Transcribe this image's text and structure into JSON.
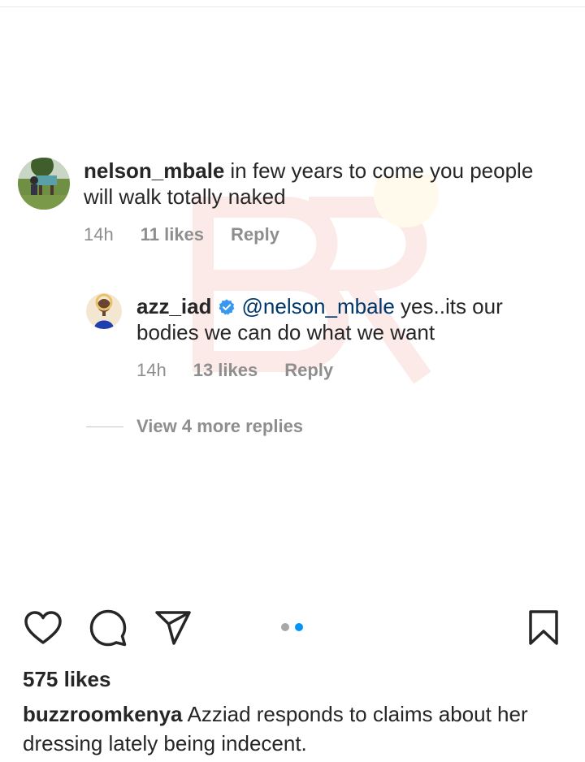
{
  "comments": [
    {
      "username": "nelson_mbale",
      "text": "in few years to come you people will walk totally naked",
      "time": "14h",
      "likes": "11 likes",
      "reply_label": "Reply",
      "verified": false
    },
    {
      "username": "azz_iad",
      "mention": "@nelson_mbale",
      "text": "yes..its our bodies we can do what we want",
      "time": "14h",
      "likes": "13 likes",
      "reply_label": "Reply",
      "verified": true
    }
  ],
  "view_replies": "View 4 more replies",
  "actions": {
    "icons": [
      "heart-icon",
      "comment-icon",
      "share-icon",
      "bookmark-icon"
    ],
    "carousel": {
      "total": 2,
      "active": 2,
      "active_color": "#0095f6",
      "inactive_color": "#a8a8a8"
    }
  },
  "post": {
    "likes": "575 likes",
    "caption_user": "buzzroomkenya",
    "caption_text": "Azziad responds to claims about her dressing lately being indecent."
  },
  "colors": {
    "text": "#262626",
    "muted": "#8e8e8e",
    "mention": "#00376b",
    "verified": "#3897f0",
    "watermark": "#e53935"
  }
}
